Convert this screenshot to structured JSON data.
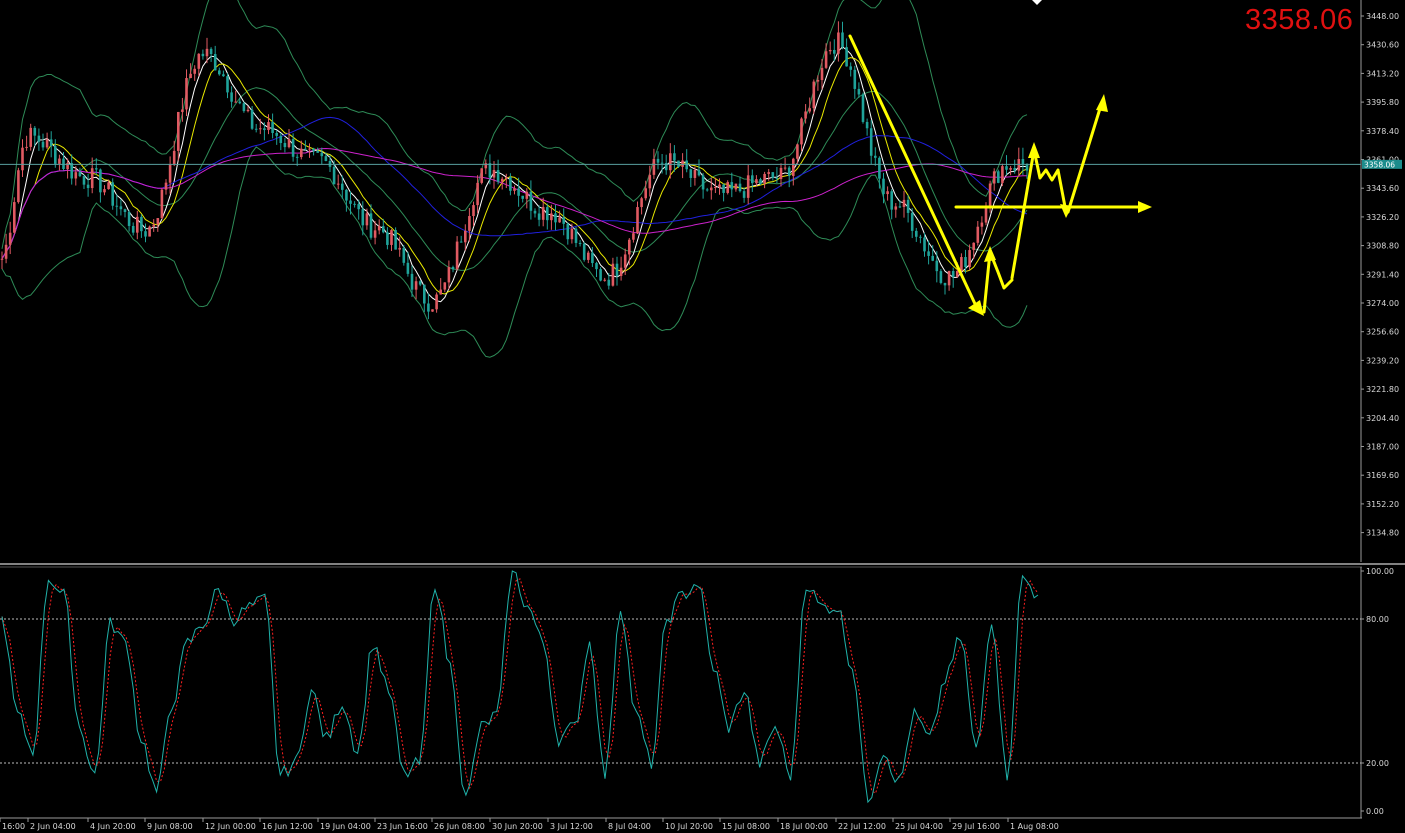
{
  "header": {
    "big_price": "3358.06"
  },
  "price_marker": {
    "label": "3358.06"
  },
  "colors": {
    "bg": "#000000",
    "bull_candle": "#e05a62",
    "bear_candle": "#1fa39a",
    "bollinger": "#2e8b57",
    "ma_fast": "#ffffff",
    "ma_mid": "#e8e800",
    "ma_slow": "#2020dd",
    "ma_long": "#cc22cc",
    "annotation": "#ffff00",
    "stoch_main": "#20b2aa",
    "stoch_signal": "#ff2020",
    "axis_text": "#d8d8d8",
    "big_price": "#e01010"
  },
  "chart_data": [
    {
      "type": "candlestick",
      "title": "",
      "y_ticks": [
        "3448.00",
        "3430.60",
        "3413.20",
        "3395.80",
        "3378.40",
        "3361.00",
        "3343.60",
        "3326.20",
        "3308.80",
        "3291.40",
        "3274.00",
        "3256.60",
        "3239.20",
        "3221.80",
        "3204.40",
        "3187.00",
        "3169.60",
        "3152.20",
        "3134.80"
      ],
      "x_ticks": [
        "16:00",
        "2 Jun 04:00",
        "4 Jun 20:00",
        "9 Jun 08:00",
        "12 Jun 00:00",
        "16 Jun 12:00",
        "19 Jun 04:00",
        "23 Jun 16:00",
        "26 Jun 08:00",
        "30 Jun 20:00",
        "3 Jul 12:00",
        "8 Jul 04:00",
        "10 Jul 20:00",
        "15 Jul 08:00",
        "18 Jul 00:00",
        "22 Jul 12:00",
        "25 Jul 04:00",
        "29 Jul 16:00",
        "1 Aug 08:00"
      ],
      "ylim": [
        3134.8,
        3448.0
      ],
      "current_price": 3358.06,
      "close_path": [
        {
          "x": "start",
          "y": 3300
        },
        {
          "x": "2 Jun 04:00",
          "y": 3375
        },
        {
          "x": "4 Jun 20:00",
          "y": 3350
        },
        {
          "x": "9 Jun 08:00",
          "y": 3318
        },
        {
          "x": "12 Jun 00:00",
          "y": 3425
        },
        {
          "x": "16 Jun 12:00",
          "y": 3380
        },
        {
          "x": "19 Jun 04:00",
          "y": 3360
        },
        {
          "x": "23 Jun 16:00",
          "y": 3320
        },
        {
          "x": "26 Jun 08:00",
          "y": 3275
        },
        {
          "x": "30 Jun 20:00",
          "y": 3355
        },
        {
          "x": "3 Jul 12:00",
          "y": 3330
        },
        {
          "x": "8 Jul 04:00",
          "y": 3290
        },
        {
          "x": "10 Jul 20:00",
          "y": 3360
        },
        {
          "x": "15 Jul 08:00",
          "y": 3340
        },
        {
          "x": "18 Jul 00:00",
          "y": 3350
        },
        {
          "x": "22 Jul 12:00",
          "y": 3432
        },
        {
          "x": "25 Jul 04:00",
          "y": 3335
        },
        {
          "x": "29 Jul 16:00",
          "y": 3290
        },
        {
          "x": "1 Aug 08:00",
          "y": 3358
        }
      ]
    },
    {
      "type": "line",
      "title": "",
      "y_ticks": [
        "100.00",
        "80.00",
        "20.00",
        "0.00"
      ],
      "levels": [
        80,
        20
      ],
      "ylim": [
        0,
        100
      ],
      "series": [
        {
          "values": [
            80,
            40,
            25,
            97,
            90,
            35,
            15,
            78,
            70,
            30,
            8,
            45,
            70,
            78,
            92,
            80,
            85,
            88,
            15,
            20,
            50,
            30,
            45,
            25,
            70,
            50,
            15,
            20,
            95,
            60,
            5,
            35,
            40,
            100,
            85,
            70,
            30,
            35,
            70,
            15,
            85,
            40,
            20,
            80,
            90,
            95,
            60,
            35,
            50,
            20,
            35,
            15,
            95,
            85,
            85,
            60,
            5,
            25,
            12,
            40,
            30,
            55,
            72,
            25,
            80,
            15,
            97,
            90
          ]
        }
      ]
    }
  ]
}
